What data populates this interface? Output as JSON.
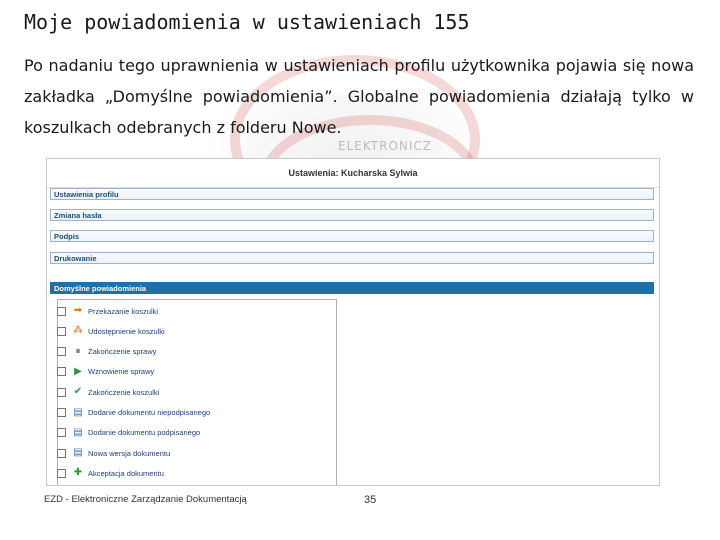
{
  "slide": {
    "title": "Moje powiadomienia w ustawieniach 155",
    "paragraph": "Po nadaniu tego uprawnienia w ustawieniach profilu użytkownika pojawia się nowa zakładka „Domyślne powiadomienia”. Globalne powiadomienia działają tylko w koszulkach odebranych z folderu Nowe.",
    "watermark": "ELEKTRONICZ"
  },
  "settings": {
    "title": "Ustawienia: Kucharska Sylwia",
    "sections": [
      {
        "label": "Ustawienia profilu"
      },
      {
        "label": "Zmiana hasła"
      },
      {
        "label": "Podpis"
      },
      {
        "label": "Drukowanie"
      },
      {
        "label": "Domyślne powiadomienia"
      }
    ],
    "notifications": [
      {
        "label": "Przekazanie koszulki",
        "icon": "arrow-right-icon",
        "color": "#e8741a",
        "glyph": "➡",
        "checked": false
      },
      {
        "label": "Udostępnienie koszulki",
        "icon": "share-icon",
        "color": "#cc7722",
        "glyph": "⁂",
        "checked": false
      },
      {
        "label": "Zakończenie sprawy",
        "icon": "pause-icon",
        "color": "#555555",
        "glyph": "⏸",
        "checked": false
      },
      {
        "label": "Wznowienie sprawy",
        "icon": "play-icon",
        "color": "#2e9a3a",
        "glyph": "▶",
        "checked": false
      },
      {
        "label": "Zakończenie koszulki",
        "icon": "checkmark-icon",
        "color": "#2e9a3a",
        "glyph": "✔",
        "checked": false
      },
      {
        "label": "Dodanie dokumentu niepodpisanego",
        "icon": "document-icon",
        "color": "#3d6fb0",
        "glyph": "▤",
        "checked": false
      },
      {
        "label": "Dodanie dokumentu podpisanego",
        "icon": "signed-document-icon",
        "color": "#3d6fb0",
        "glyph": "▤",
        "checked": false
      },
      {
        "label": "Nowa wersja dokumentu",
        "icon": "new-version-icon",
        "color": "#3d6fb0",
        "glyph": "▤",
        "checked": false
      },
      {
        "label": "Akceptacja dokumentu",
        "icon": "accept-icon",
        "color": "#2e9a3a",
        "glyph": "✚",
        "checked": false
      }
    ]
  },
  "footer": {
    "text": "EZD - Elektroniczne Zarządzanie Dokumentacją",
    "page_number": "35"
  }
}
